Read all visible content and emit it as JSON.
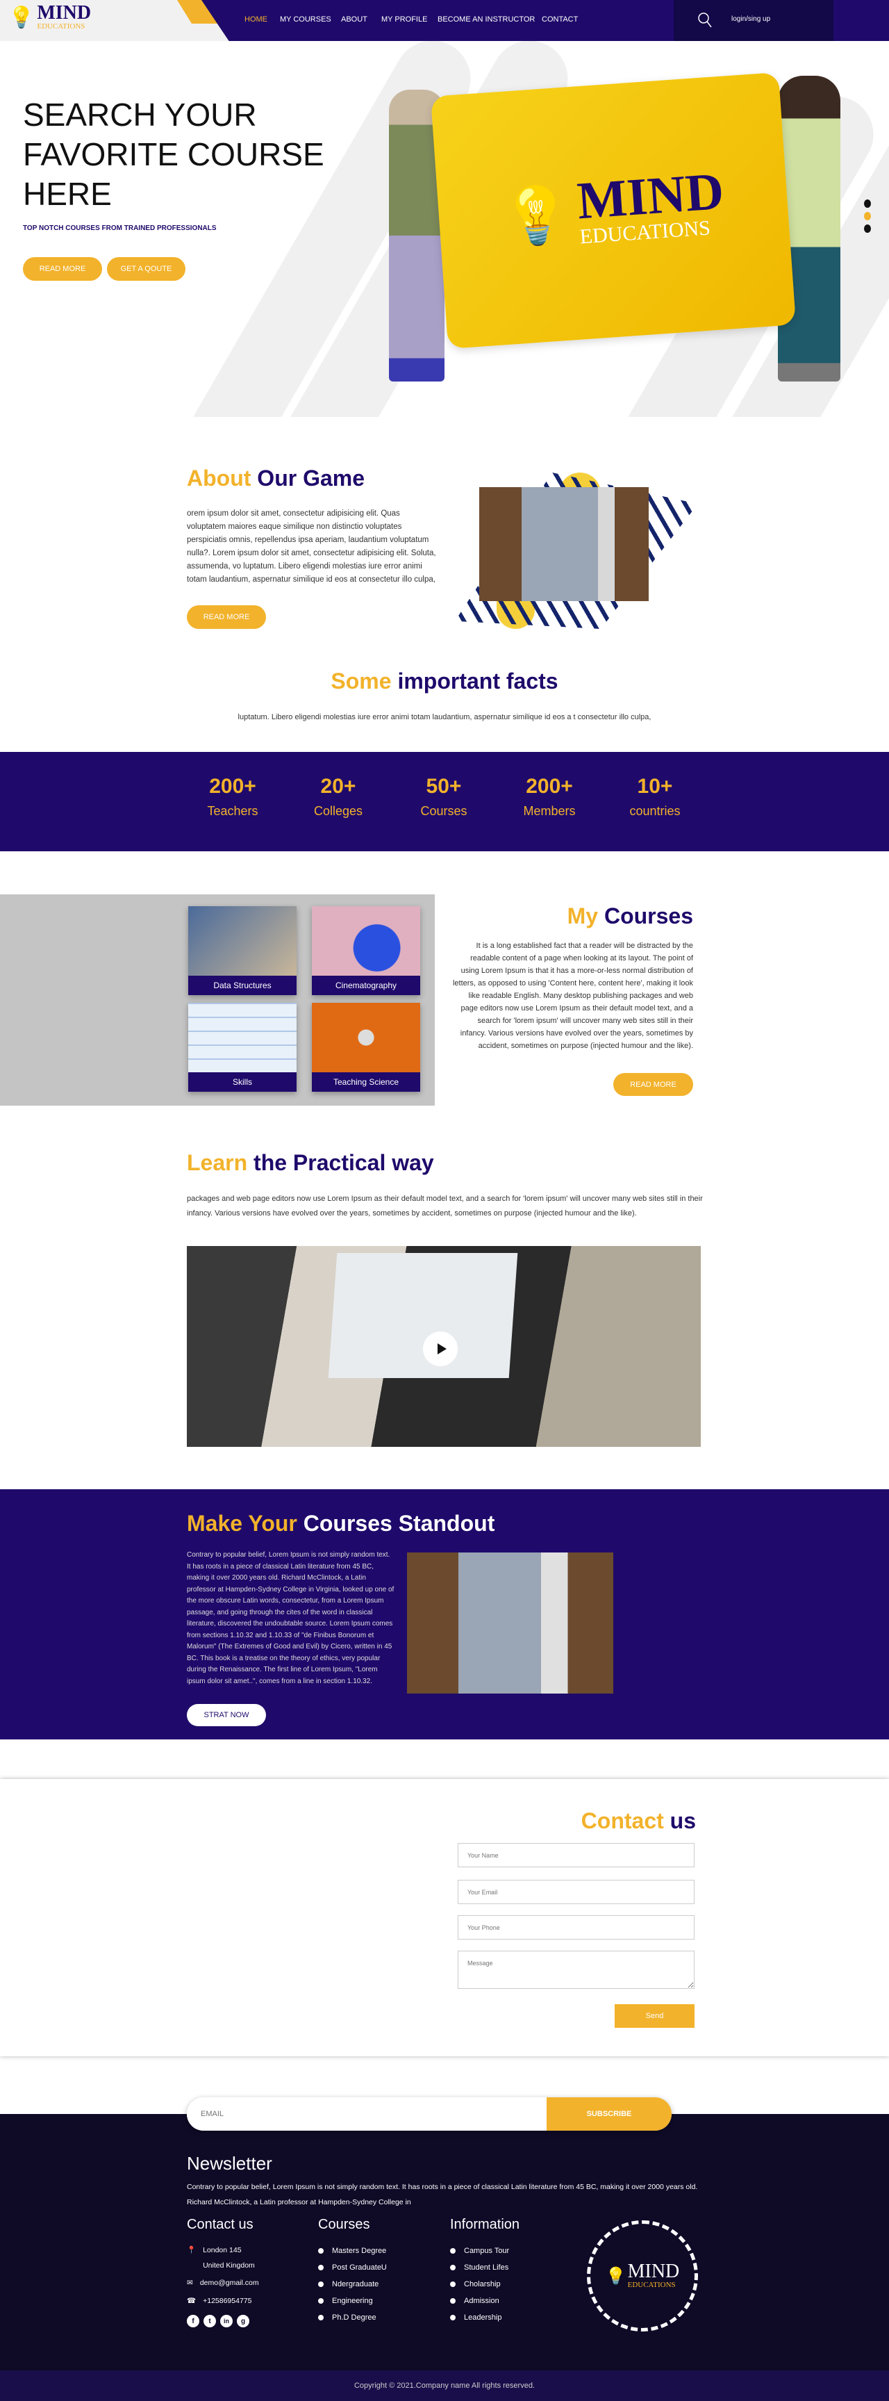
{
  "colors": {
    "purple": "#1f0a6b",
    "yellow": "#f2b22b",
    "footer": "#0f0a26"
  },
  "brand": {
    "name": "MIND",
    "sub": "EDUCATIONS"
  },
  "nav": {
    "items": [
      {
        "label": "HOME",
        "active": true
      },
      {
        "label": "MY COURSES"
      },
      {
        "label": "ABOUT"
      },
      {
        "label": "MY PROFILE"
      },
      {
        "label": "BECOME AN INSTRUCTOR"
      },
      {
        "label": "CONTACT"
      }
    ],
    "login": "login/sing up",
    "search_icon": "search-icon"
  },
  "hero": {
    "title_lines": [
      "SEARCH YOUR",
      "FAVORITE COURSE",
      "HERE"
    ],
    "subtitle": "TOP NOTCH COURSES FROM TRAINED PROFESSIONALS",
    "read_more": "READ MORE",
    "quote": "GET A QOUTE",
    "slider_active": 2
  },
  "about": {
    "title_a": "About",
    "title_b": "Our Game",
    "text": "orem ipsum dolor sit amet, consectetur adipisicing elit. Quas voluptatem maiores eaque similique non distinctio voluptates perspiciatis omnis, repellendus ipsa aperiam, laudantium voluptatum nulla?. Lorem ipsum dolor sit amet, consectetur adipisicing elit. Soluta, assumenda, vo luptatum. Libero eligendi molestias iure error animi totam laudantium, aspernatur similique id eos at consectetur illo culpa,",
    "button": "READ MORE"
  },
  "facts": {
    "title_a": "Some",
    "title_b": "important facts",
    "text": "luptatum. Libero eligendi molestias iure error animi totam laudantium, aspernatur similique id eos a t consectetur illo culpa,",
    "stats": [
      {
        "n": "200+",
        "l": "Teachers"
      },
      {
        "n": "20+",
        "l": "Colleges"
      },
      {
        "n": "50+",
        "l": "Courses"
      },
      {
        "n": "200+",
        "l": "Members"
      },
      {
        "n": "10+",
        "l": "countries"
      }
    ]
  },
  "courses": {
    "title_a": "My",
    "title_b": "Courses",
    "cards": [
      "Data Structures",
      "Cinematography",
      "Skills",
      "Teaching Science"
    ],
    "text": "It is a long established fact that a reader will be distracted by the readable content of a page when looking at its layout. The point of using Lorem Ipsum is that it has a more-or-less normal distribution of letters, as opposed to using 'Content here, content here', making it look like readable English. Many desktop publishing packages and web page editors now use Lorem Ipsum as their default model text, and a search for 'lorem ipsum' will uncover many web sites still in their infancy. Various versions have evolved over the years, sometimes by accident, sometimes on purpose (injected humour and the like).",
    "button": "READ MORE"
  },
  "learn": {
    "title_a": "Learn",
    "title_b": "the Practical way",
    "text": "packages and web page editors now use Lorem Ipsum as their default model text, and a search for 'lorem ipsum' will uncover many web sites still in their infancy. Various versions have evolved over the years, sometimes by accident, sometimes on purpose (injected humour and the like)."
  },
  "standout": {
    "title_a": "Make Your",
    "title_b": "Courses Standout",
    "text": "Contrary to popular belief, Lorem Ipsum is not simply random text. It has roots in a piece of classical Latin literature from 45 BC, making it over 2000 years old. Richard McClintock, a Latin professor at Hampden-Sydney College in Virginia, looked up one of the more obscure Latin words, consectetur, from a Lorem Ipsum passage, and going through the cites of the word in classical literature, discovered the undoubtable source. Lorem Ipsum comes from sections 1.10.32 and 1.10.33 of \"de Finibus Bonorum et Malorum\" (The Extremes of Good and Evil) by Cicero, written in 45 BC. This book is a treatise on the theory of ethics, very popular during the Renaissance. The first line of Lorem Ipsum, \"Lorem ipsum dolor sit amet..\", comes from a line in section 1.10.32.",
    "button": "STRAT NOW"
  },
  "contact": {
    "title_a": "Contact",
    "title_b": "us",
    "name": "Your Name",
    "email": "Your Email",
    "phone": "Your Phone",
    "message": "Message",
    "send": "Send"
  },
  "subscribe": {
    "placeholder": "EMAIL",
    "button": "SUBSCRIBE"
  },
  "footer": {
    "newsletter": "Newsletter",
    "text": "Contrary to popular belief, Lorem Ipsum is not simply random text. It has roots in a piece of classical Latin literature from 45 BC, making it over 2000 years old. Richard McClintock, a Latin professor at Hampden-Sydney College in",
    "contact_title": "Contact us",
    "address1": "London 145",
    "address2": "United Kingdom",
    "email": "demo@gmail.com",
    "phone": "+12586954775",
    "courses_title": "Courses",
    "courses": [
      "Masters Degree",
      "Post GraduateU",
      "Ndergraduate",
      "Engineering",
      "Ph.D Degree"
    ],
    "info_title": "Information",
    "info": [
      "Campus Tour",
      "Student Lifes",
      "Cholarship",
      "Admission",
      "Leadership"
    ],
    "social": [
      "f",
      "t",
      "in",
      "g"
    ],
    "copyright": "Copyright © 2021.Company name All rights reserved."
  }
}
